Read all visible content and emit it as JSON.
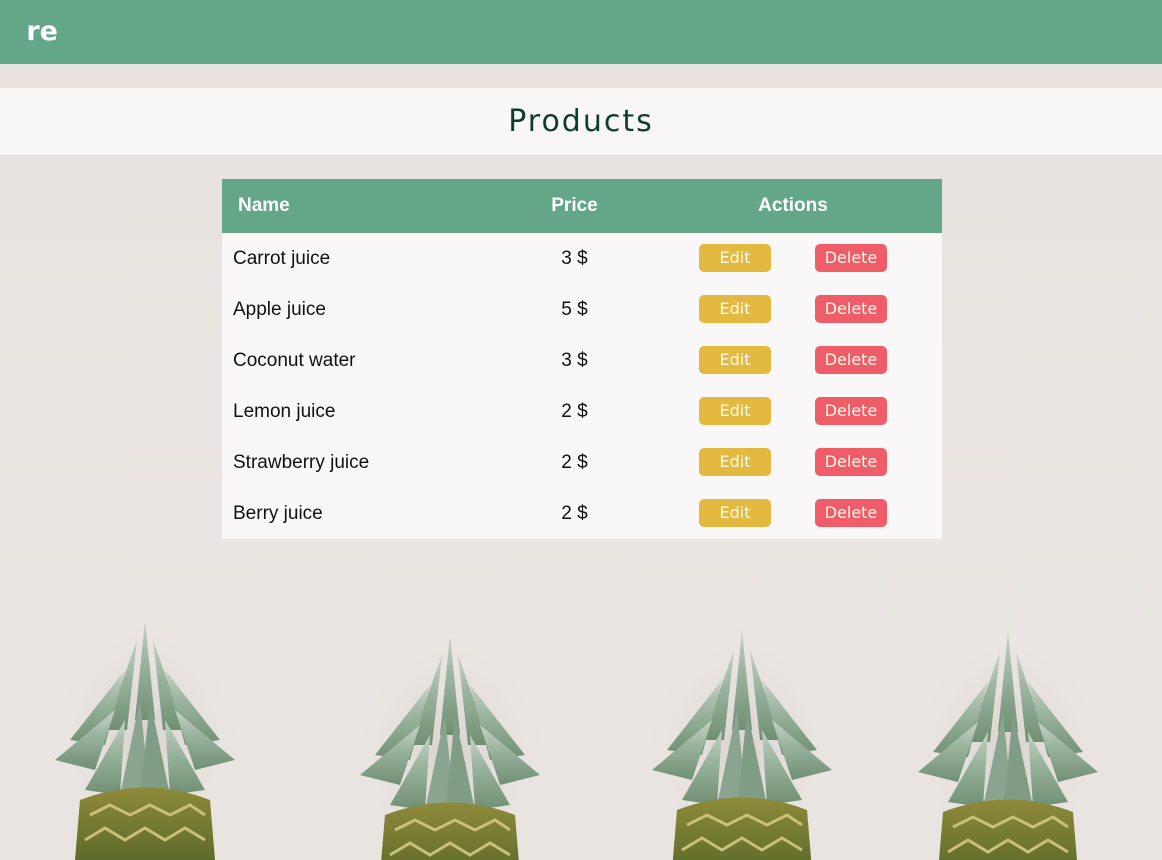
{
  "header": {
    "brand": "re"
  },
  "page": {
    "title": "Products"
  },
  "table": {
    "columns": [
      "Name",
      "Price",
      "Actions"
    ],
    "rows": [
      {
        "name": "Carrot juice",
        "price": "3 $",
        "edit": "Edit",
        "delete": "Delete"
      },
      {
        "name": "Apple juice",
        "price": "5 $",
        "edit": "Edit",
        "delete": "Delete"
      },
      {
        "name": "Coconut water",
        "price": "3 $",
        "edit": "Edit",
        "delete": "Delete"
      },
      {
        "name": "Lemon juice",
        "price": "2 $",
        "edit": "Edit",
        "delete": "Delete"
      },
      {
        "name": "Strawberry juice",
        "price": "2 $",
        "edit": "Edit",
        "delete": "Delete"
      },
      {
        "name": "Berry juice",
        "price": "2 $",
        "edit": "Edit",
        "delete": "Delete"
      }
    ]
  },
  "colors": {
    "primary": "#63a688",
    "title": "#0d3e2a",
    "edit": "#e3b940",
    "delete": "#ef5e68"
  },
  "background": {
    "image": "pineapple-row-image"
  }
}
